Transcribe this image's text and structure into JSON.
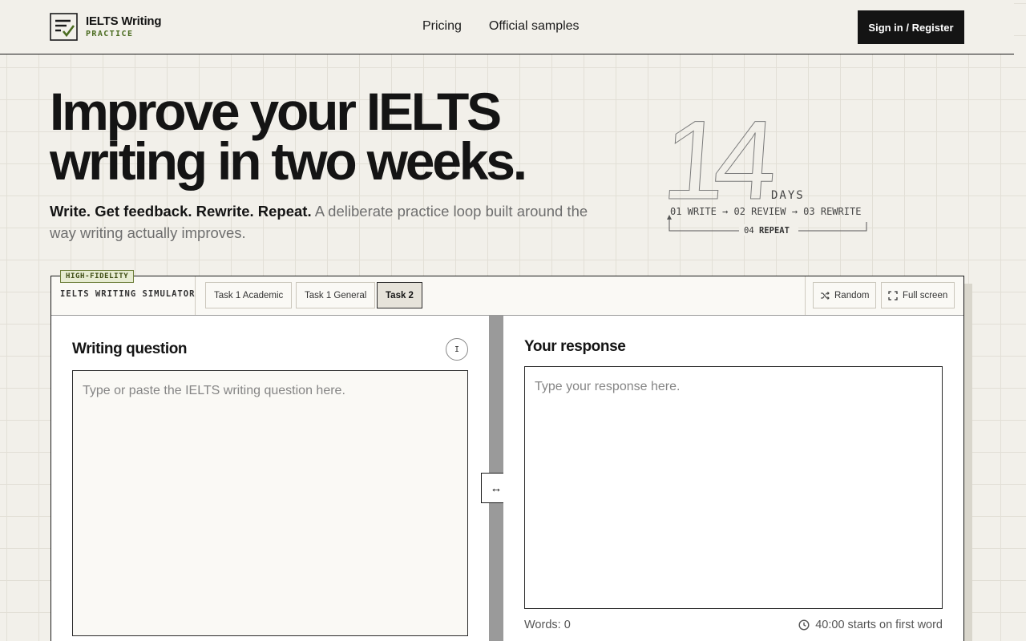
{
  "header": {
    "logo_title": "IELTS Writing",
    "logo_subtitle": "PRACTICE",
    "nav": [
      {
        "label": "Pricing"
      },
      {
        "label": "Official samples"
      }
    ],
    "signin_label": "Sign in / Register"
  },
  "hero": {
    "title_line1": "Improve your IELTS",
    "title_line2": "writing in two weeks.",
    "subtitle_bold": "Write. Get feedback. Rewrite. Repeat.",
    "subtitle_rest": " A deliberate practice loop built around the way writing actually improves.",
    "days_number": "14",
    "days_label": "DAYS",
    "loop_steps": "01 WRITE → 02 REVIEW → 03 REWRITE",
    "loop_repeat_num": "04",
    "loop_repeat_label": "REPEAT"
  },
  "simulator": {
    "badge": "HIGH-FIDELITY",
    "label": "IELTS WRITING SIMULATOR",
    "tabs": [
      {
        "label": "Task 1 Academic"
      },
      {
        "label": "Task 1 General"
      },
      {
        "label": "Task 2"
      }
    ],
    "active_tab": "Task 2",
    "random_label": "Random",
    "fullscreen_label": "Full screen",
    "question_title": "Writing question",
    "info_glyph": "I",
    "question_placeholder": "Type or paste the IELTS writing question here.",
    "question_value": "",
    "response_title": "Your response",
    "response_placeholder": "Type your response here.",
    "response_value": "",
    "word_count": "Words: 0",
    "timer": "40:00 starts on first word",
    "drag_glyph": "↔"
  },
  "colors": {
    "accent_green": "#4a6b1f",
    "ink": "#141414",
    "paper": "#f2f0ea"
  }
}
